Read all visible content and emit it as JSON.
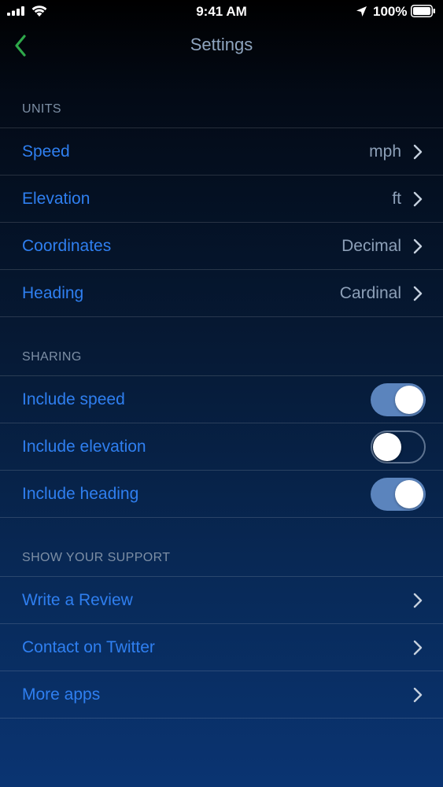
{
  "status_bar": {
    "time": "9:41 AM",
    "battery_percent": "100%",
    "icons": [
      "signal-icon",
      "wifi-icon",
      "location-arrow-icon",
      "battery-icon"
    ]
  },
  "nav": {
    "title": "Settings",
    "back_icon": "chevron-left-icon"
  },
  "colors": {
    "accent": "#2f7ff0",
    "back_chevron": "#2ea84a",
    "value_text": "#8da0b8",
    "header_text": "#7d8fa5",
    "toggle_on": "#5b84bd"
  },
  "units": {
    "header": "UNITS",
    "rows": [
      {
        "label": "Speed",
        "value": "mph"
      },
      {
        "label": "Elevation",
        "value": "ft"
      },
      {
        "label": "Coordinates",
        "value": "Decimal"
      },
      {
        "label": "Heading",
        "value": "Cardinal"
      }
    ]
  },
  "sharing": {
    "header": "SHARING",
    "rows": [
      {
        "label": "Include speed",
        "on": true
      },
      {
        "label": "Include elevation",
        "on": false
      },
      {
        "label": "Include heading",
        "on": true
      }
    ]
  },
  "support": {
    "header": "SHOW YOUR SUPPORT",
    "rows": [
      {
        "label": "Write a Review"
      },
      {
        "label": "Contact on Twitter"
      },
      {
        "label": "More apps"
      }
    ]
  }
}
